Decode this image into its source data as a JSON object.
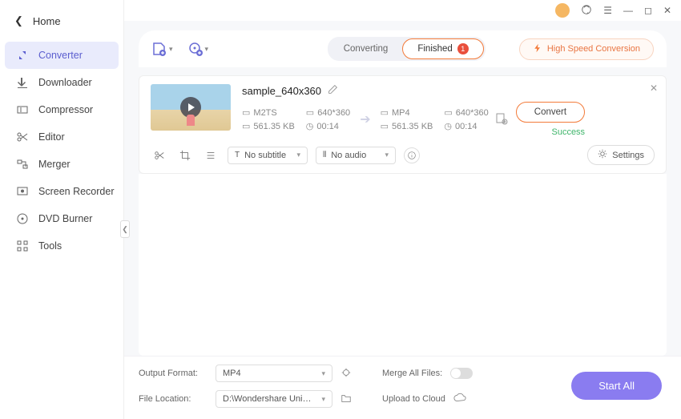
{
  "home": {
    "label": "Home"
  },
  "sidebar": {
    "items": [
      {
        "label": "Converter"
      },
      {
        "label": "Downloader"
      },
      {
        "label": "Compressor"
      },
      {
        "label": "Editor"
      },
      {
        "label": "Merger"
      },
      {
        "label": "Screen Recorder"
      },
      {
        "label": "DVD Burner"
      },
      {
        "label": "Tools"
      }
    ]
  },
  "tabs": {
    "converting": "Converting",
    "finished": "Finished",
    "finished_count": "1"
  },
  "hs_conversion": "High Speed Conversion",
  "file": {
    "name": "sample_640x360",
    "source": {
      "format": "M2TS",
      "res": "640*360",
      "size": "561.35 KB",
      "dur": "00:14"
    },
    "target": {
      "format": "MP4",
      "res": "640*360",
      "size": "561.35 KB",
      "dur": "00:14"
    },
    "convert_btn": "Convert",
    "status": "Success",
    "subtitle_sel": "No subtitle",
    "audio_sel": "No audio",
    "settings_btn": "Settings"
  },
  "footer": {
    "output_format_label": "Output Format:",
    "output_format_value": "MP4",
    "file_location_label": "File Location:",
    "file_location_value": "D:\\Wondershare UniConverter 1",
    "merge_label": "Merge All Files:",
    "upload_label": "Upload to Cloud",
    "start_all": "Start All"
  }
}
